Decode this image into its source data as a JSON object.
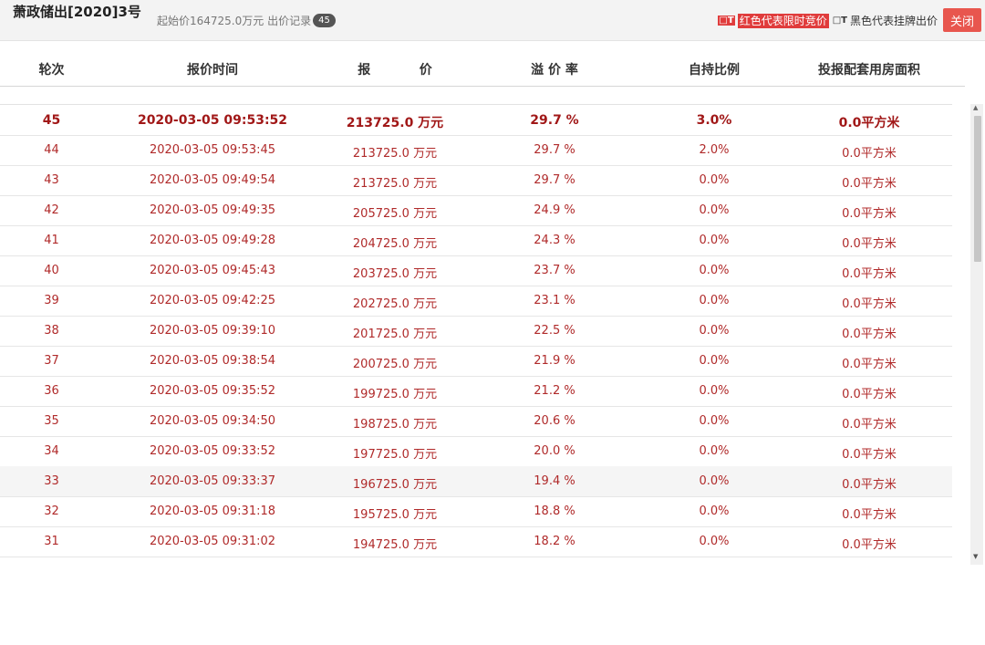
{
  "header": {
    "title": "萧政储出[2020]3号",
    "start_price_text": "起始价164725.0万元 出价记录",
    "bid_count": "45",
    "legend_red_symbol": "□T",
    "legend_red_text": "红色代表限时竞价",
    "legend_black_symbol": "□T",
    "legend_black_text": "黑色代表挂牌出价",
    "close_label": "关闭"
  },
  "columns": {
    "round": "轮次",
    "time": "报价时间",
    "price": "报           价",
    "premium": "溢 价 率",
    "self_ratio": "自持比例",
    "housing_area": "投报配套用房面积"
  },
  "rows": [
    {
      "round": "45",
      "time": "2020-03-05 09:53:52",
      "price": "213725.0 万元",
      "premium": "29.7 %",
      "self_ratio": "3.0%",
      "area": "0.0平方米"
    },
    {
      "round": "44",
      "time": "2020-03-05 09:53:45",
      "price": "213725.0 万元",
      "premium": "29.7 %",
      "self_ratio": "2.0%",
      "area": "0.0平方米"
    },
    {
      "round": "43",
      "time": "2020-03-05 09:49:54",
      "price": "213725.0 万元",
      "premium": "29.7 %",
      "self_ratio": "0.0%",
      "area": "0.0平方米"
    },
    {
      "round": "42",
      "time": "2020-03-05 09:49:35",
      "price": "205725.0 万元",
      "premium": "24.9 %",
      "self_ratio": "0.0%",
      "area": "0.0平方米"
    },
    {
      "round": "41",
      "time": "2020-03-05 09:49:28",
      "price": "204725.0 万元",
      "premium": "24.3 %",
      "self_ratio": "0.0%",
      "area": "0.0平方米"
    },
    {
      "round": "40",
      "time": "2020-03-05 09:45:43",
      "price": "203725.0 万元",
      "premium": "23.7 %",
      "self_ratio": "0.0%",
      "area": "0.0平方米"
    },
    {
      "round": "39",
      "time": "2020-03-05 09:42:25",
      "price": "202725.0 万元",
      "premium": "23.1 %",
      "self_ratio": "0.0%",
      "area": "0.0平方米"
    },
    {
      "round": "38",
      "time": "2020-03-05 09:39:10",
      "price": "201725.0 万元",
      "premium": "22.5 %",
      "self_ratio": "0.0%",
      "area": "0.0平方米"
    },
    {
      "round": "37",
      "time": "2020-03-05 09:38:54",
      "price": "200725.0 万元",
      "premium": "21.9 %",
      "self_ratio": "0.0%",
      "area": "0.0平方米"
    },
    {
      "round": "36",
      "time": "2020-03-05 09:35:52",
      "price": "199725.0 万元",
      "premium": "21.2 %",
      "self_ratio": "0.0%",
      "area": "0.0平方米"
    },
    {
      "round": "35",
      "time": "2020-03-05 09:34:50",
      "price": "198725.0 万元",
      "premium": "20.6 %",
      "self_ratio": "0.0%",
      "area": "0.0平方米"
    },
    {
      "round": "34",
      "time": "2020-03-05 09:33:52",
      "price": "197725.0 万元",
      "premium": "20.0 %",
      "self_ratio": "0.0%",
      "area": "0.0平方米"
    },
    {
      "round": "33",
      "time": "2020-03-05 09:33:37",
      "price": "196725.0 万元",
      "premium": "19.4 %",
      "self_ratio": "0.0%",
      "area": "0.0平方米"
    },
    {
      "round": "32",
      "time": "2020-03-05 09:31:18",
      "price": "195725.0 万元",
      "premium": "18.8 %",
      "self_ratio": "0.0%",
      "area": "0.0平方米"
    },
    {
      "round": "31",
      "time": "2020-03-05 09:31:02",
      "price": "194725.0 万元",
      "premium": "18.2 %",
      "self_ratio": "0.0%",
      "area": "0.0平方米"
    }
  ],
  "scrollbar": {
    "up_icon": "arrow-up-icon",
    "down_icon": "arrow-down-icon"
  }
}
